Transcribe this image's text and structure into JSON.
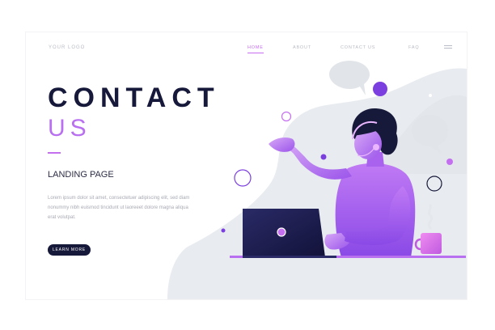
{
  "header": {
    "logo": "YOUR LOGO",
    "nav": [
      {
        "label": "HOME",
        "active": true
      },
      {
        "label": "ABOUT",
        "active": false
      },
      {
        "label": "CONTACT US",
        "active": false
      },
      {
        "label": "FAQ",
        "active": false
      }
    ],
    "menu_icon": "hamburger-menu-icon"
  },
  "hero": {
    "title_line1": "CONTACT",
    "title_line2": "US",
    "subtitle": "LANDING PAGE",
    "body": "Lorem ipsum dolor sit amet, consectetuer adipiscing elit, sed diam nonummy nibh euismod tincidunt ut laoreeet dolore magna aliqua erat volutpat.",
    "button_label": "LEARN MORE"
  },
  "colors": {
    "navy": "#17193a",
    "purple": "#b86ff0",
    "violet": "#7b3fe0",
    "blob": "#e8ebef"
  }
}
